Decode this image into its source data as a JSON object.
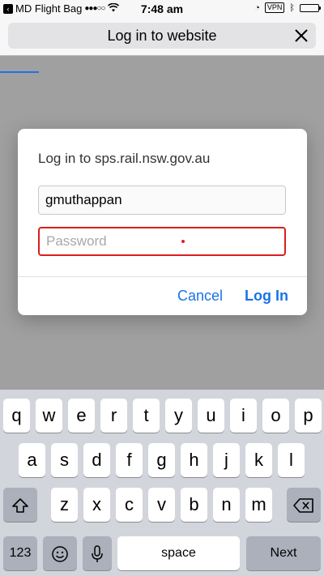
{
  "status_bar": {
    "app_name": "MD Flight Bag",
    "time": "7:48 am",
    "vpn": "VPN"
  },
  "nav": {
    "title": "Log in to website"
  },
  "dialog": {
    "title": "Log in to sps.rail.nsw.gov.au",
    "username_value": "gmuthappan",
    "password_placeholder": "Password",
    "cancel_label": "Cancel",
    "login_label": "Log In"
  },
  "keyboard": {
    "row1": [
      "q",
      "w",
      "e",
      "r",
      "t",
      "y",
      "u",
      "i",
      "o",
      "p"
    ],
    "row2": [
      "a",
      "s",
      "d",
      "f",
      "g",
      "h",
      "j",
      "k",
      "l"
    ],
    "row3": [
      "z",
      "x",
      "c",
      "v",
      "b",
      "n",
      "m"
    ],
    "numbers_label": "123",
    "space_label": "space",
    "next_label": "Next"
  },
  "colors": {
    "accent": "#1a73e8",
    "error_border": "#d81e1e",
    "keyboard_bg": "#d2d5db"
  }
}
